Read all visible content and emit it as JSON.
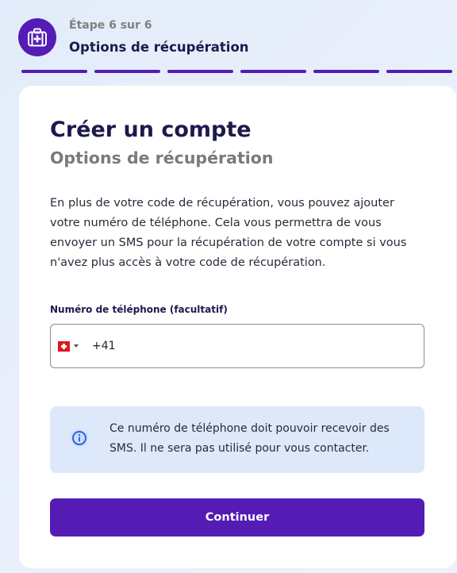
{
  "header": {
    "step_icon": "medical-kit-icon",
    "step_count": "Étape 6 sur 6",
    "step_title": "Options de récupération",
    "progress_total": 6,
    "progress_completed": 6
  },
  "card": {
    "title": "Créer un compte",
    "subtitle": "Options de récupération",
    "intro": "En plus de votre code de récupération, vous pouvez ajouter votre numéro de téléphone. Cela vous permettra de vous envoyer un SMS pour la récupération de votre compte si vous n'avez plus accès à votre code de récupération.",
    "phone_label": "Numéro de téléphone (facultatif)",
    "phone_country_icon": "swiss-flag-icon",
    "phone_value": "+41",
    "info_icon": "info-icon",
    "info_text": "Ce numéro de téléphone doit pouvoir recevoir des SMS. Il ne sera pas utilisé pour vous contacter.",
    "continue_label": "Continuer"
  },
  "colors": {
    "accent": "#541cb5",
    "info_background": "#dde8fb",
    "title_text": "#1c1a4c"
  }
}
